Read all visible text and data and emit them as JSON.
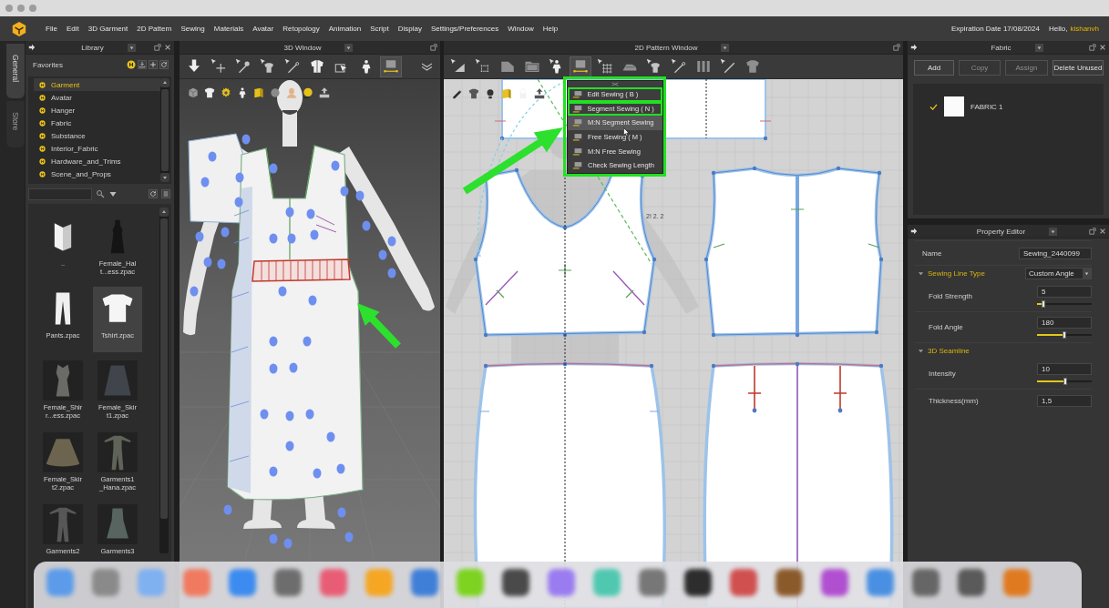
{
  "menu_bar": {
    "items": [
      "File",
      "Edit",
      "3D Garment",
      "2D Pattern",
      "Sewing",
      "Materials",
      "Avatar",
      "Retopology",
      "Animation",
      "Script",
      "Display",
      "Settings/Preferences",
      "Window",
      "Help"
    ],
    "expiration": "Expiration Date 17/08/2024",
    "greeting": "Hello,",
    "user": "kishanvh"
  },
  "side_tabs": [
    {
      "label": "General",
      "selected": true
    },
    {
      "label": "Store",
      "selected": false
    }
  ],
  "library": {
    "title": "Library",
    "favorites_label": "Favorites",
    "favorites": [
      {
        "label": "Garment",
        "selected": true
      },
      {
        "label": "Avatar",
        "selected": false
      },
      {
        "label": "Hanger",
        "selected": false
      },
      {
        "label": "Fabric",
        "selected": false
      },
      {
        "label": "Substance",
        "selected": false
      },
      {
        "label": "Interior_Fabric",
        "selected": false
      },
      {
        "label": "Hardware_and_Trims",
        "selected": false
      },
      {
        "label": "Scene_and_Props",
        "selected": false
      }
    ],
    "files": [
      {
        "label": "..",
        "selected": false
      },
      {
        "label": "Female_Hal\nt...ess.zpac",
        "selected": false
      },
      {
        "label": "Pants.zpac",
        "selected": false
      },
      {
        "label": "Tshirt.zpac",
        "selected": true
      },
      {
        "label": "Female_Shir\nr...ess.zpac",
        "selected": false
      },
      {
        "label": "Female_Skir\nt1.zpac",
        "selected": false
      },
      {
        "label": "Female_Skir\nt2.zpac",
        "selected": false
      },
      {
        "label": "Garments1\n_Hana.zpac",
        "selected": false
      },
      {
        "label": "Garments2",
        "selected": false
      },
      {
        "label": "Garments3",
        "selected": false
      }
    ]
  },
  "window_3d": {
    "title": "3D Window",
    "tools": [
      {
        "selected": false
      },
      {
        "selected": false
      },
      {
        "selected": false
      },
      {
        "selected": false
      },
      {
        "selected": false
      },
      {
        "selected": false
      },
      {
        "selected": false
      },
      {
        "selected": false
      },
      {
        "selected": true
      }
    ]
  },
  "pattern_window": {
    "title": "2D Pattern Window",
    "tools": [
      {
        "selected": false
      },
      {
        "selected": false
      },
      {
        "selected": false
      },
      {
        "selected": false
      },
      {
        "selected": false
      },
      {
        "selected": true
      },
      {
        "selected": false
      },
      {
        "selected": false
      },
      {
        "selected": false
      },
      {
        "selected": false
      },
      {
        "selected": false
      },
      {
        "selected": false
      },
      {
        "selected": false
      }
    ],
    "sewing_menu": [
      {
        "label": "Edit Sewing ( B )",
        "highlighted": true,
        "hovered": false
      },
      {
        "label": "Segment Sewing ( N )",
        "highlighted": true,
        "hovered": false
      },
      {
        "label": "M:N Segment Sewing",
        "highlighted": false,
        "hovered": true
      },
      {
        "label": "Free Sewing ( M )",
        "highlighted": false,
        "hovered": false
      },
      {
        "label": "M:N Free Sewing",
        "highlighted": false,
        "hovered": false
      },
      {
        "label": "Check Sewing Length",
        "highlighted": false,
        "hovered": false
      }
    ],
    "canvas_label": "2! 2. 2"
  },
  "fabric": {
    "title": "Fabric",
    "buttons": [
      {
        "label": "Add",
        "disabled": false
      },
      {
        "label": "Copy",
        "disabled": true
      },
      {
        "label": "Assign",
        "disabled": true
      },
      {
        "label": "Delete Unused",
        "disabled": false
      }
    ],
    "items": [
      {
        "label": "FABRIC 1",
        "checked": true
      }
    ]
  },
  "property_editor": {
    "title": "Property Editor",
    "rows": [
      {
        "kind": "field",
        "label": "Name",
        "value": "Sewing_2440099"
      },
      {
        "kind": "section",
        "label": "Sewing Line Type",
        "value": "Custom Angle",
        "expanded": true,
        "children": [
          {
            "kind": "slider",
            "label": "Fold Strength",
            "value": "5",
            "level": 0.12
          },
          {
            "kind": "slider",
            "label": "Fold Angle",
            "value": "180",
            "level": 0.5
          }
        ]
      },
      {
        "kind": "section",
        "label": "3D Seamline",
        "expanded": true,
        "children": [
          {
            "kind": "slider",
            "label": "Intensity",
            "value": "10",
            "level": 0.52
          },
          {
            "kind": "input",
            "label": "Thickness(mm)",
            "value": "1,5"
          }
        ]
      }
    ]
  }
}
